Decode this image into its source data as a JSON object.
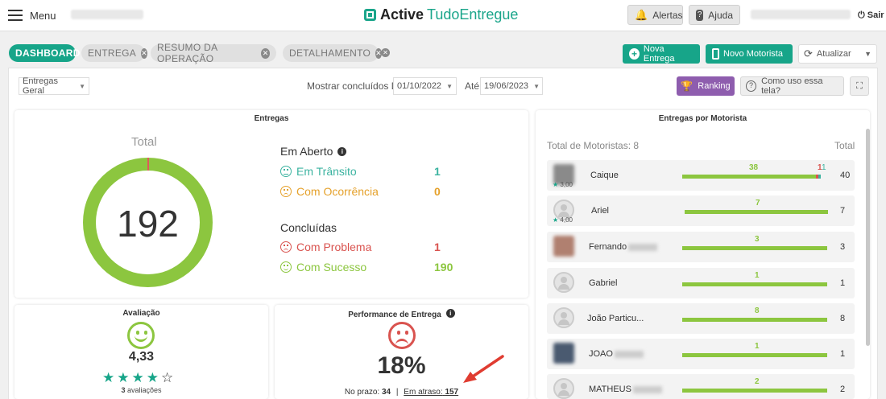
{
  "header": {
    "menu_label": "Menu",
    "logo_bold": "Active",
    "logo_light": "TudoEntregue",
    "alerts_label": "Alertas",
    "help_label": "Ajuda",
    "logout_label": "Sair"
  },
  "tabs": [
    {
      "label": "DASHBOARD",
      "active": true
    },
    {
      "label": "ENTREGA",
      "active": false
    },
    {
      "label": "RESUMO DA OPERAÇÃO",
      "active": false
    },
    {
      "label": "DETALHAMENTO",
      "active": false
    }
  ],
  "actions": {
    "nova_entrega": "Nova Entrega",
    "novo_motorista": "Novo Motorista",
    "atualizar": "Atualizar"
  },
  "filters": {
    "tipo": "Entregas Geral",
    "mostrar_label": "Mostrar concluídos De",
    "date_from": "01/10/2022",
    "ate_label": "Até",
    "date_to": "19/06/2023",
    "ranking": "Ranking",
    "como_uso": "Como uso essa tela?"
  },
  "entregas": {
    "title": "Entregas",
    "total_label": "Total",
    "total": "192",
    "em_aberto_label": "Em Aberto",
    "em_transito_label": "Em Trânsito",
    "em_transito": "1",
    "com_ocorrencia_label": "Com Ocorrência",
    "com_ocorrencia": "0",
    "concluidas_label": "Concluídas",
    "com_problema_label": "Com Problema",
    "com_problema": "1",
    "com_sucesso_label": "Com Sucesso",
    "com_sucesso": "190"
  },
  "avaliacao": {
    "title": "Avaliação",
    "score": "4,33",
    "count": "3",
    "count_label": "avaliações",
    "stars_filled": 4,
    "stars_total": 5
  },
  "performance": {
    "title": "Performance de Entrega",
    "percent": "18%",
    "no_prazo_label": "No prazo:",
    "no_prazo": "34",
    "separator": "|",
    "em_atraso_label": "Em atraso:",
    "em_atraso": "157"
  },
  "motoristas": {
    "title": "Entregas por Motorista",
    "total_label": "Total de Motoristas: 8",
    "col_total": "Total",
    "rows": [
      {
        "name": "Caique",
        "rating": "3,00",
        "bar_label": "38",
        "extra": "1",
        "extra2": "1",
        "total": "40"
      },
      {
        "name": "Ariel",
        "rating": "4,00",
        "bar_label": "7",
        "total": "7"
      },
      {
        "name": "Fernando",
        "bar_label": "3",
        "total": "3"
      },
      {
        "name": "Gabriel",
        "bar_label": "1",
        "total": "1"
      },
      {
        "name": "João Particu...",
        "bar_label": "8",
        "total": "8"
      },
      {
        "name": "JOAO",
        "bar_label": "1",
        "total": "1"
      },
      {
        "name": "MATHEUS",
        "bar_label": "2",
        "total": "2"
      }
    ]
  },
  "colors": {
    "accent": "#17a589",
    "success": "#8cc63f",
    "warning": "#e5a12b",
    "danger": "#d9534f",
    "info": "#3bb3a0",
    "ranking": "#8e5dae"
  }
}
